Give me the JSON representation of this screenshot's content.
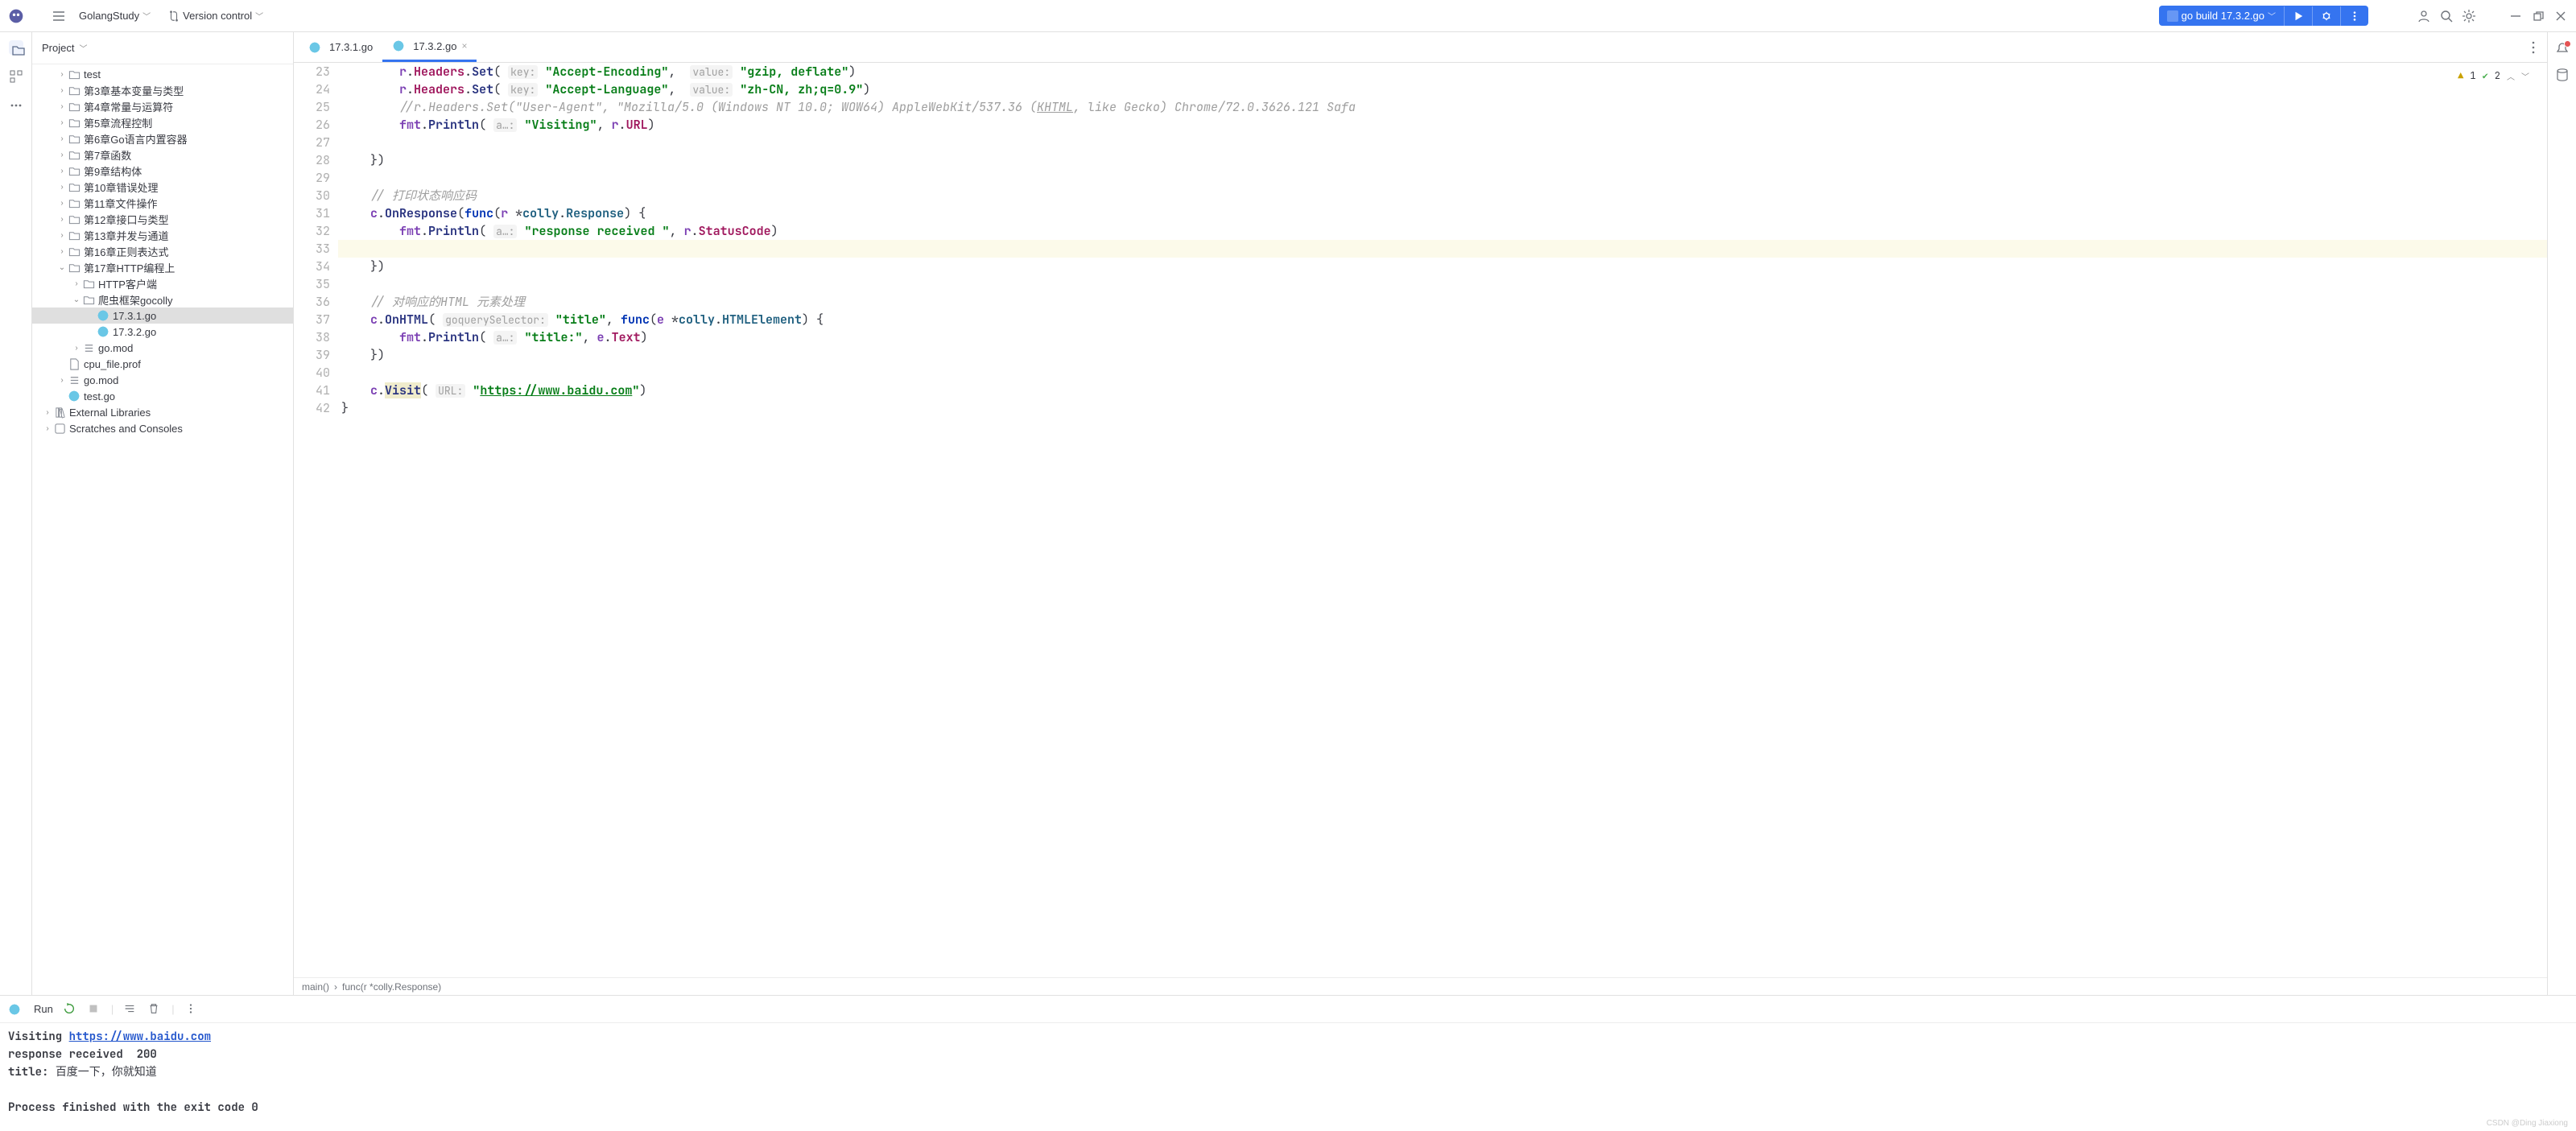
{
  "titlebar": {
    "project": "GolangStudy",
    "vcs": "Version control",
    "run_label": "go build 17.3.2.go"
  },
  "project_pane": {
    "title": "Project",
    "items": [
      {
        "depth": 1,
        "arrow": ">",
        "icon": "folder",
        "label": "test"
      },
      {
        "depth": 1,
        "arrow": ">",
        "icon": "folder",
        "label": "第3章基本变量与类型"
      },
      {
        "depth": 1,
        "arrow": ">",
        "icon": "folder",
        "label": "第4章常量与运算符"
      },
      {
        "depth": 1,
        "arrow": ">",
        "icon": "folder",
        "label": "第5章流程控制"
      },
      {
        "depth": 1,
        "arrow": ">",
        "icon": "folder",
        "label": "第6章Go语言内置容器"
      },
      {
        "depth": 1,
        "arrow": ">",
        "icon": "folder",
        "label": "第7章函数"
      },
      {
        "depth": 1,
        "arrow": ">",
        "icon": "folder",
        "label": "第9章结构体"
      },
      {
        "depth": 1,
        "arrow": ">",
        "icon": "folder",
        "label": "第10章错误处理"
      },
      {
        "depth": 1,
        "arrow": ">",
        "icon": "folder",
        "label": "第11章文件操作"
      },
      {
        "depth": 1,
        "arrow": ">",
        "icon": "folder",
        "label": "第12章接口与类型"
      },
      {
        "depth": 1,
        "arrow": ">",
        "icon": "folder",
        "label": "第13章并发与通道"
      },
      {
        "depth": 1,
        "arrow": ">",
        "icon": "folder",
        "label": "第16章正则表达式"
      },
      {
        "depth": 1,
        "arrow": "v",
        "icon": "folder",
        "label": "第17章HTTP编程上"
      },
      {
        "depth": 2,
        "arrow": ">",
        "icon": "folder",
        "label": "HTTP客户端"
      },
      {
        "depth": 2,
        "arrow": "v",
        "icon": "folder",
        "label": "爬虫框架gocolly"
      },
      {
        "depth": 3,
        "arrow": "",
        "icon": "go",
        "label": "17.3.1.go",
        "selected": true
      },
      {
        "depth": 3,
        "arrow": "",
        "icon": "go",
        "label": "17.3.2.go"
      },
      {
        "depth": 2,
        "arrow": ">",
        "icon": "list",
        "label": "go.mod"
      },
      {
        "depth": 1,
        "arrow": "",
        "icon": "file",
        "label": "cpu_file.prof"
      },
      {
        "depth": 1,
        "arrow": ">",
        "icon": "list",
        "label": "go.mod"
      },
      {
        "depth": 1,
        "arrow": "",
        "icon": "go",
        "label": "test.go"
      },
      {
        "depth": 0,
        "arrow": ">",
        "icon": "lib",
        "label": "External Libraries"
      },
      {
        "depth": 0,
        "arrow": ">",
        "icon": "scratch",
        "label": "Scratches and Consoles"
      }
    ]
  },
  "tabs": [
    {
      "icon": "go",
      "label": "17.3.1.go",
      "active": false,
      "closeable": false
    },
    {
      "icon": "go",
      "label": "17.3.2.go",
      "active": true,
      "closeable": true
    }
  ],
  "inspections": {
    "warn": "1",
    "ok": "2"
  },
  "gutter_start": 23,
  "code_html": [
    "        <span class='tok-id'>r</span>.<span class='tok-field'>Headers</span>.<span class='tok-fn'>Set</span>( <span class='tok-hint'>key:</span> <span class='tok-str'>\"Accept-Encoding\"</span>,  <span class='tok-hint'>value:</span> <span class='tok-str'>\"gzip, deflate\"</span>)",
    "        <span class='tok-id'>r</span>.<span class='tok-field'>Headers</span>.<span class='tok-fn'>Set</span>( <span class='tok-hint'>key:</span> <span class='tok-str'>\"Accept-Language\"</span>,  <span class='tok-hint'>value:</span> <span class='tok-str'>\"zh-CN, zh;q=0.9\"</span>)",
    "        <span class='tok-cmt'>//r.Headers.Set(\"User-Agent\", \"Mozilla/5.0 (Windows NT 10.0; WOW64) AppleWebKit/537.36 (<u>KHTML</u>, like Gecko) Chrome/72.0.3626.121 Safa</span>",
    "        <span class='tok-id'>fmt</span>.<span class='tok-fn'>Println</span>( <span class='tok-hint'>a…:</span> <span class='tok-str'>\"Visiting\"</span>, <span class='tok-id'>r</span>.<span class='tok-field'>URL</span>)",
    "",
    "    })",
    "",
    "    <span class='tok-cmt'>// 打印状态响应码</span>",
    "    <span class='tok-id'>c</span>.<span class='tok-fn'>OnResponse</span>(<span class='tok-kw'>func</span>(<span class='tok-id'>r</span> *<span class='tok-type'>colly</span>.<span class='tok-type'>Response</span>) {",
    "        <span class='tok-id'>fmt</span>.<span class='tok-fn'>Println</span>( <span class='tok-hint'>a…:</span> <span class='tok-str'>\"response received \"</span>, <span class='tok-id'>r</span>.<span class='tok-field'>StatusCode</span>)",
    "",
    "    })",
    "",
    "    <span class='tok-cmt'>// 对响应的HTML 元素处理</span>",
    "    <span class='tok-id'>c</span>.<span class='tok-fn'>OnHTML</span>( <span class='tok-hint'>goquerySelector:</span> <span class='tok-str'>\"title\"</span>, <span class='tok-kw'>func</span>(<span class='tok-id'>e</span> *<span class='tok-type'>colly</span>.<span class='tok-type'>HTMLElement</span>) {",
    "        <span class='tok-id'>fmt</span>.<span class='tok-fn'>Println</span>( <span class='tok-hint'>a…:</span> <span class='tok-str'>\"title:\"</span>, <span class='tok-id'>e</span>.<span class='tok-field'>Text</span>)",
    "    })",
    "",
    "    <span class='tok-id'>c</span>.<span class='tok-fn tok-visit'>Visit</span>( <span class='tok-hint'>URL:</span> <span class='tok-str'>\"<span class='tok-link'>https://www.baidu.com</span>\"</span>)",
    "}"
  ],
  "code_hl_index": 10,
  "breadcrumbs": [
    "main()",
    "func(r *colly.Response)"
  ],
  "run_header": {
    "label": "Run"
  },
  "console": {
    "line1_prefix": "Visiting ",
    "line1_link": "https://www.baidu.com",
    "line2": "response received  200",
    "line3_prefix": "title: ",
    "line3_cn": "百度一下，你就知道",
    "exit": "Process finished with the exit code 0"
  },
  "watermark": "CSDN @Ding Jiaxiong"
}
